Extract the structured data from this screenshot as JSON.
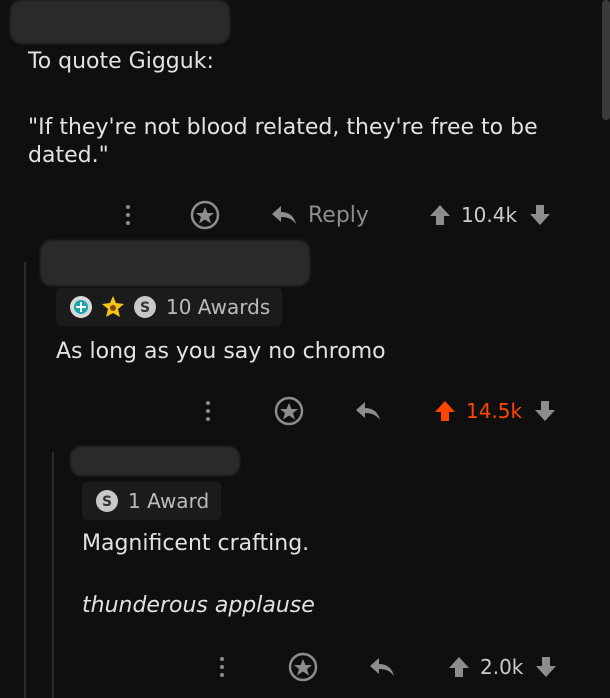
{
  "comment1": {
    "line1": "To quote Gigguk:",
    "quote": "\"If they're not blood related, they're free to be dated.\"",
    "reply_label": "Reply",
    "score": "10.4k"
  },
  "comment2": {
    "awards_label": "10 Awards",
    "body": "As long as you say no chromo",
    "score": "14.5k",
    "score_color": "#ff4500"
  },
  "comment3": {
    "awards_label": "1 Award",
    "line1": "Magnificent crafting.",
    "line2": "thunderous applause",
    "score": "2.0k"
  },
  "icons": [
    "more-dots-icon",
    "award-icon",
    "reply-arrow-icon",
    "upvote-icon",
    "downvote-icon",
    "helpful-award-icon",
    "wholesome-award-icon",
    "silver-award-icon"
  ]
}
